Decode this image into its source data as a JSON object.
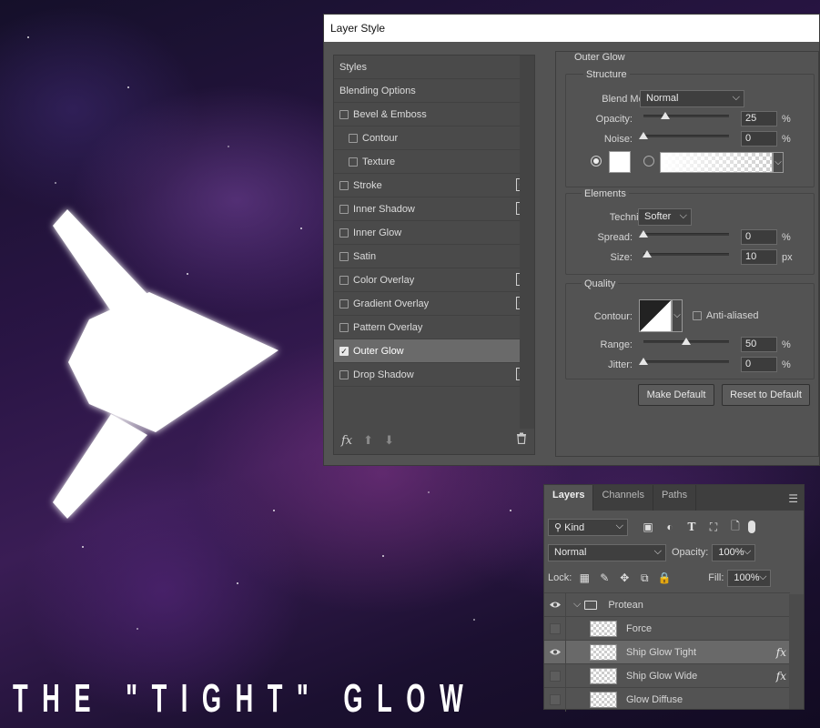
{
  "caption": "THE \"TIGHT\" GLOW",
  "dialog": {
    "title": "Layer Style",
    "styles": [
      {
        "label": "Styles",
        "type": "header"
      },
      {
        "label": "Blending Options",
        "type": "header"
      },
      {
        "label": "Bevel & Emboss",
        "type": "check",
        "checked": false,
        "plus": false
      },
      {
        "label": "Contour",
        "type": "sub",
        "checked": false
      },
      {
        "label": "Texture",
        "type": "sub",
        "checked": false
      },
      {
        "label": "Stroke",
        "type": "check",
        "checked": false,
        "plus": true
      },
      {
        "label": "Inner Shadow",
        "type": "check",
        "checked": false,
        "plus": true
      },
      {
        "label": "Inner Glow",
        "type": "check",
        "checked": false,
        "plus": false
      },
      {
        "label": "Satin",
        "type": "check",
        "checked": false,
        "plus": false
      },
      {
        "label": "Color Overlay",
        "type": "check",
        "checked": false,
        "plus": true
      },
      {
        "label": "Gradient Overlay",
        "type": "check",
        "checked": false,
        "plus": true
      },
      {
        "label": "Pattern Overlay",
        "type": "check",
        "checked": false,
        "plus": false
      },
      {
        "label": "Outer Glow",
        "type": "check",
        "checked": true,
        "plus": false,
        "active": true
      },
      {
        "label": "Drop Shadow",
        "type": "check",
        "checked": false,
        "plus": true
      }
    ],
    "footer": {
      "fx_label": "fx"
    },
    "outer_glow": {
      "title": "Outer Glow",
      "structure": {
        "title": "Structure",
        "blend_mode_label": "Blend Mode:",
        "blend_mode": "Normal",
        "opacity_label": "Opacity:",
        "opacity": "25",
        "opacity_value": 25,
        "noise_label": "Noise:",
        "noise": "0",
        "noise_value": 0,
        "pct": "%"
      },
      "elements": {
        "title": "Elements",
        "technique_label": "Technique:",
        "technique": "Softer",
        "spread_label": "Spread:",
        "spread": "0",
        "spread_value": 0,
        "size_label": "Size:",
        "size": "10",
        "size_value": 10,
        "pct": "%",
        "px": "px"
      },
      "quality": {
        "title": "Quality",
        "contour_label": "Contour:",
        "anti_aliased_label": "Anti-aliased",
        "range_label": "Range:",
        "range": "50",
        "range_value": 50,
        "jitter_label": "Jitter:",
        "jitter": "0",
        "jitter_value": 0,
        "pct": "%"
      },
      "make_default": "Make Default",
      "reset_default": "Reset to Default"
    }
  },
  "layers_panel": {
    "tabs": [
      "Layers",
      "Channels",
      "Paths"
    ],
    "filter": "Kind",
    "blend": "Normal",
    "opacity_label": "Opacity:",
    "opacity": "100%",
    "lock_label": "Lock:",
    "fill_label": "Fill:",
    "fill": "100%",
    "layers": [
      {
        "name": "Protean",
        "visible": true,
        "group": true
      },
      {
        "name": "Force",
        "visible": false,
        "fx": false
      },
      {
        "name": "Ship Glow Tight",
        "visible": true,
        "fx": true,
        "selected": true
      },
      {
        "name": "Ship Glow Wide",
        "visible": false,
        "fx": true
      },
      {
        "name": "Glow Diffuse",
        "visible": false,
        "fx": false
      }
    ],
    "fx_label": "fx"
  }
}
